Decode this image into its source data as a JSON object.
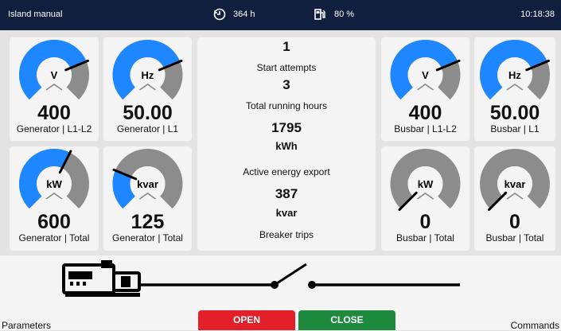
{
  "header": {
    "mode": "Island manual",
    "running_hours": "364 h",
    "fuel_level": "80 %",
    "clock": "10:18:38"
  },
  "gauges": [
    {
      "label": "V",
      "value": "400",
      "sub": "Generator | L1-L2",
      "fill_fraction": 0.75
    },
    {
      "label": "Hz",
      "value": "50.00",
      "sub": "Generator | L1",
      "fill_fraction": 0.75
    },
    {
      "label": "kW",
      "value": "600",
      "sub": "Generator | Total",
      "fill_fraction": 0.6
    },
    {
      "label": "kvar",
      "value": "125",
      "sub": "Generator | Total",
      "fill_fraction": 0.25
    },
    {
      "label": "V",
      "value": "400",
      "sub": "Busbar | L1-L2",
      "fill_fraction": 0.75
    },
    {
      "label": "Hz",
      "value": "50.00",
      "sub": "Busbar | L1",
      "fill_fraction": 0.75
    },
    {
      "label": "kW",
      "value": "0",
      "sub": "Busbar | Total",
      "fill_fraction": 0
    },
    {
      "label": "kvar",
      "value": "0",
      "sub": "Busbar | Total",
      "fill_fraction": 0
    }
  ],
  "center": {
    "start_attempts_value": "1",
    "start_attempts_label": "Start attempts",
    "running_hours_value": "3",
    "running_hours_label": "Total running hours",
    "energy_value": "1795",
    "energy_unit": "kWh",
    "energy_label": "Active energy export",
    "reactive_value": "387",
    "reactive_unit": "kvar",
    "breaker_label": "Breaker trips"
  },
  "buttons": {
    "open": "OPEN",
    "close": "CLOSE"
  },
  "footer": {
    "left": "Parameters",
    "right": "Commands"
  },
  "colors": {
    "blue": "#1e86ff",
    "gray": "#8c8c8c",
    "open": "#e3202a",
    "close": "#1d8a3e",
    "topbar": "#0f1f3d"
  }
}
